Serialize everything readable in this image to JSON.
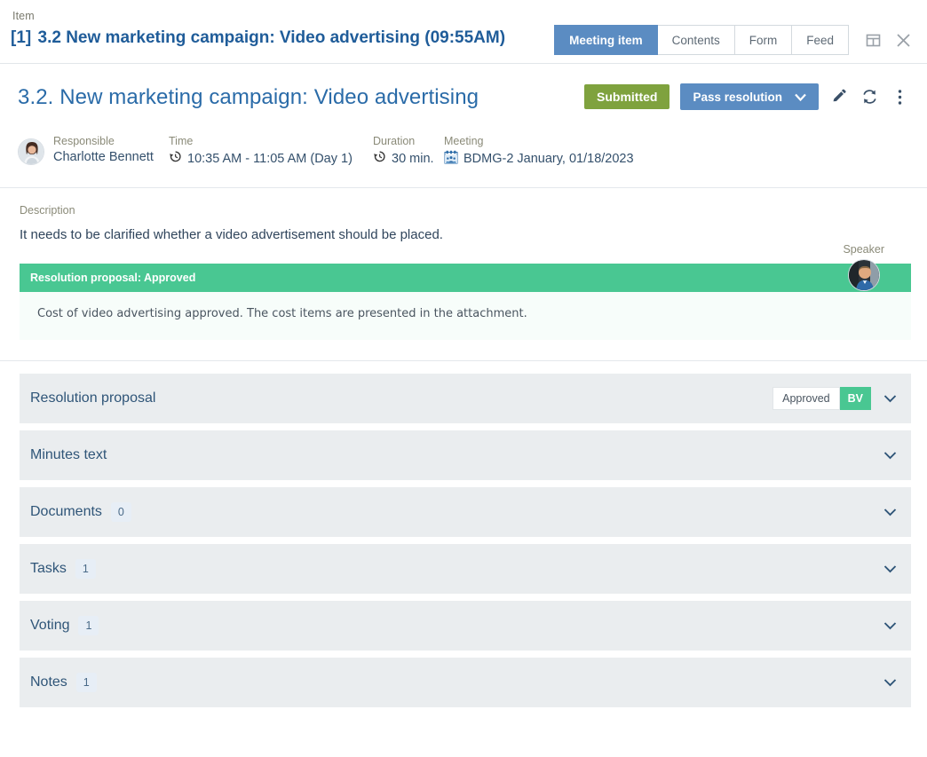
{
  "topbar": {
    "crumb_label": "Item",
    "doc_title_index": "[1]",
    "doc_title": "3.2 New marketing campaign: Video advertising (09:55AM)",
    "tabs": [
      {
        "label": "Meeting item",
        "active": true
      },
      {
        "label": "Contents",
        "active": false
      },
      {
        "label": "Form",
        "active": false
      },
      {
        "label": "Feed",
        "active": false
      }
    ],
    "icons": {
      "panel": "panel-layout-icon",
      "close": "close-icon"
    }
  },
  "header": {
    "title": "3.2. New marketing campaign: Video advertising",
    "status_label": "Submitted",
    "primary_action_label": "Pass resolution",
    "edit_icon": "pencil-icon",
    "refresh_icon": "refresh-icon",
    "more_icon": "more-vertical-icon"
  },
  "meta": {
    "responsible": {
      "label": "Responsible",
      "value": "Charlotte Bennett"
    },
    "time": {
      "label": "Time",
      "value": "10:35 AM - 11:05 AM (Day 1)",
      "icon": "clock-history-icon"
    },
    "duration": {
      "label": "Duration",
      "value": "30 min.",
      "icon": "clock-history-icon"
    },
    "meeting": {
      "label": "Meeting",
      "value": "BDMG-2 January, 01/18/2023",
      "icon": "calendar-meeting-icon"
    },
    "speaker": {
      "label": "Speaker"
    }
  },
  "description": {
    "label": "Description",
    "text": "It needs to be clarified whether a video advertisement should be placed."
  },
  "resolution_callout": {
    "heading": "Resolution proposal: Approved",
    "body": "Cost of video advertising approved. The cost items are presented in the attachment."
  },
  "accordion": [
    {
      "title": "Resolution proposal",
      "count": null,
      "chip": "Approved",
      "initials": "BV"
    },
    {
      "title": "Minutes text",
      "count": null,
      "chip": null,
      "initials": null
    },
    {
      "title": "Documents",
      "count": "0",
      "chip": null,
      "initials": null
    },
    {
      "title": "Tasks",
      "count": "1",
      "chip": null,
      "initials": null
    },
    {
      "title": "Voting",
      "count": "1",
      "chip": null,
      "initials": null
    },
    {
      "title": "Notes",
      "count": "1",
      "chip": null,
      "initials": null
    }
  ],
  "colors": {
    "accent_blue": "#5b8cc2",
    "status_green": "#7fa23e",
    "resolution_green": "#49c792",
    "title_blue": "#2a6ba8",
    "panel_gray": "#eaedef"
  }
}
